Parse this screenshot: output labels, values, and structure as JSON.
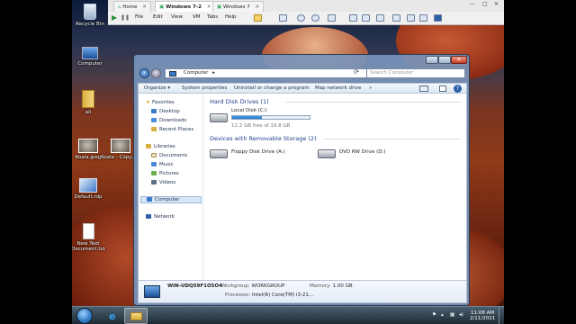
{
  "vm": {
    "tabs": [
      {
        "label": "Home"
      },
      {
        "label": "Windows 7-2",
        "active": true
      },
      {
        "label": "Windows 7"
      }
    ],
    "menu": [
      "File",
      "Edit",
      "View",
      "VM",
      "Tabs",
      "Help"
    ],
    "window_controls": [
      "—",
      "□",
      "✕"
    ]
  },
  "desktop": {
    "icons": [
      {
        "label": "Recycle Bin",
        "icon": "recycle-bin-icon"
      },
      {
        "label": "Computer",
        "icon": "computer-icon"
      },
      {
        "label": "ali",
        "icon": "folder-icon"
      },
      {
        "label": "Koala.jpeg",
        "icon": "image-icon"
      },
      {
        "label": "Koala - Copy.jpg",
        "icon": "image-icon"
      },
      {
        "label": "Default.rdp",
        "icon": "remote-desktop-icon"
      },
      {
        "label": "New Text Document.txt",
        "icon": "text-file-icon"
      }
    ]
  },
  "explorer": {
    "address": "Computer",
    "search_placeholder": "Search Computer",
    "commands": [
      "Organize ▾",
      "System properties",
      "Uninstall or change a program",
      "Map network drive",
      "»"
    ],
    "nav": {
      "favorites": "Favorites",
      "favorite_items": [
        "Desktop",
        "Downloads",
        "Recent Places"
      ],
      "libraries": "Libraries",
      "library_items": [
        "Documents",
        "Music",
        "Pictures",
        "Videos"
      ],
      "computer": "Computer",
      "network": "Network"
    },
    "groups": {
      "hdd": "Hard Disk Drives (1)",
      "removable": "Devices with Removable Storage (2)"
    },
    "drives": {
      "local_disk": {
        "label": "Local Disk (C:)",
        "free_text": "12.2 GB free of 19.8 GB",
        "used_fraction": 0.38
      },
      "floppy": {
        "label": "Floppy Disk Drive (A:)"
      },
      "dvd": {
        "label": "DVD RW Drive (D:)"
      }
    },
    "details": {
      "name": "WIN-UDQ59F1O5O4",
      "workgroup_key": "Workgroup:",
      "workgroup": "WORKGROUP",
      "memory_key": "Memory:",
      "memory": "1.00 GB",
      "processor_key": "Processor:",
      "processor": "Intel(R) Core(TM) i3-21..."
    }
  },
  "taskbar": {
    "time": "11:08 AM",
    "date": "2/11/2021"
  },
  "colors": {
    "accent": "#1e3d8a",
    "disk_fill": "#1b74c8"
  }
}
